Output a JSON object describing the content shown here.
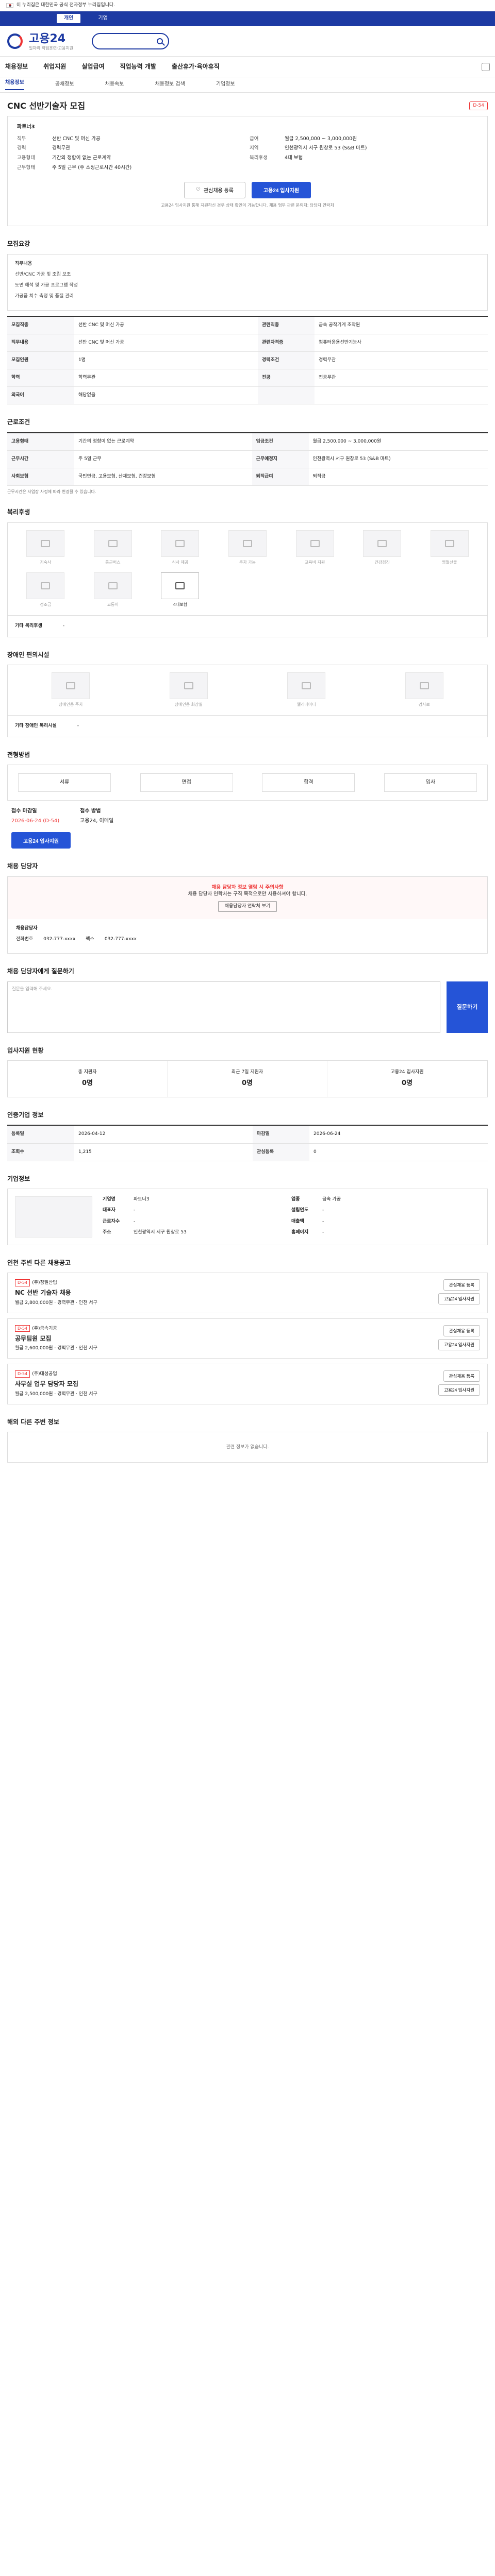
{
  "gov_banner": "이 누리집은 대한민국 공식 전자정부 누리집입니다.",
  "member_tabs": [
    "개인",
    "기업"
  ],
  "logo": {
    "title": "고용24",
    "sub": "일자리·직업훈련·고용지원"
  },
  "gnb": [
    "채용정보",
    "취업지원",
    "실업급여",
    "직업능력 개발",
    "출산휴가·육아휴직"
  ],
  "crumbs": [
    "채용정보",
    "공채정보",
    "채용속보",
    "채용정보 검색",
    "기업정보"
  ],
  "title": "CNC 선반기술자 모집",
  "dday": "D-54",
  "summary": {
    "company_head": "파트너3",
    "rows": [
      [
        "직무",
        "선반 CNC 및 머신 가공",
        "급여",
        "월급 2,500,000 ~ 3,000,000원"
      ],
      [
        "경력",
        "경력무관",
        "지역",
        "인천광역시 서구 원창로 53 (S&B 마트)"
      ],
      [
        "고용형태",
        "기간의 정함이 없는 근로계약",
        "복리후생",
        "4대 보험"
      ],
      [
        "근무형태",
        "주 5일 근무 (주 소정근로시간 40시간)",
        "",
        ""
      ]
    ]
  },
  "actions": {
    "save": "관심채용 등록",
    "apply": "고용24 입사지원"
  },
  "action_note": "고용24 입사지원 통해 지원하신 경우 상태 확인이 가능합니다. 채용 업무 관련 문의처: 담당자 연락처",
  "recruit": {
    "title": "모집요강",
    "desc_title": "직무내용",
    "desc": [
      "선반/CNC 가공 및 조립 보조",
      "도면 해석 및 가공 프로그램 작성",
      "가공품 치수 측정 및 품질 관리"
    ],
    "rows": [
      [
        "모집직종",
        "선반 CNC 및 머신 가공",
        "관련직종",
        "금속 공작기계 조작원"
      ],
      [
        "직무내용",
        "선반 CNC 및 머신 가공",
        "관련자격증",
        "컴퓨터응용선반기능사"
      ],
      [
        "모집인원",
        "1명",
        "경력조건",
        "경력무관"
      ],
      [
        "학력",
        "학력무관",
        "전공",
        "전공무관"
      ],
      [
        "외국어",
        "해당없음",
        "",
        ""
      ]
    ]
  },
  "conditions": {
    "title": "근로조건",
    "rows": [
      [
        "고용형태",
        "기간의 정함이 없는 근로계약",
        "임금조건",
        "월급 2,500,000 ~ 3,000,000원"
      ],
      [
        "근무시간",
        "주 5일 근무",
        "근무예정지",
        "인천광역시 서구 원창로 53 (S&B 마트)"
      ],
      [
        "사회보험",
        "국민연금, 고용보험, 산재보험, 건강보험",
        "퇴직급여",
        "퇴직금"
      ]
    ],
    "note": "근무시간은 사업장 사정에 따라 변경될 수 있습니다."
  },
  "welfare": {
    "title": "복리후생",
    "items": [
      "기숙사",
      "통근버스",
      "식사 제공",
      "주차 가능",
      "교육비 지원",
      "건강검진",
      "명절선물",
      "경조금",
      "교통비",
      "4대보험"
    ],
    "on": [
      9
    ],
    "extra_label": "기타 복리후생",
    "extra": "-"
  },
  "disabled": {
    "title": "장애인 편의시설",
    "items": [
      "장애인용 주차",
      "장애인용 화장실",
      "엘리베이터",
      "경사로"
    ],
    "extra_label": "기타 장애인 복리시설",
    "extra": "-"
  },
  "process": {
    "title": "전형방법",
    "steps": [
      "서류",
      "면접",
      "합격",
      "입사"
    ],
    "deadline_label": "접수 마감일",
    "deadline": "2026-06-24 (D-54)",
    "method_label": "접수 방법",
    "method": "고용24, 이메일"
  },
  "contact": {
    "title": "채용 담당자",
    "banner": "채용 담당자 정보 열람 시 주의사항",
    "sub": "채용 담당자 연락처는 구직 목적으로만 사용하셔야 합니다.",
    "button": "채용담당자 연락처 보기",
    "name_label": "채용담당자",
    "phone_label": "전화번호",
    "phone": "032-777-xxxx",
    "fax_label": "팩스",
    "fax": "032-777-xxxx"
  },
  "inquiry": {
    "title": "채용 담당자에게 질문하기",
    "placeholder": "질문을 입력해 주세요.",
    "button": "질문하기"
  },
  "stats": {
    "title": "입사지원 현황",
    "items": [
      {
        "label": "총 지원자",
        "value": "0명"
      },
      {
        "label": "최근 7일 지원자",
        "value": "0명"
      },
      {
        "label": "고용24 입사지원",
        "value": "0명"
      }
    ]
  },
  "info": {
    "title": "인증기업 정보",
    "rows": [
      [
        "등록일",
        "2026-04-12",
        "마감일",
        "2026-06-24"
      ],
      [
        "조회수",
        "1,215",
        "관심등록",
        "0"
      ]
    ]
  },
  "company": {
    "title": "기업정보",
    "rows": [
      [
        "기업명",
        "파트너3",
        "업종",
        "금속 가공"
      ],
      [
        "대표자",
        "-",
        "설립연도",
        "-"
      ],
      [
        "근로자수",
        "-",
        "매출액",
        "-"
      ],
      [
        "주소",
        "인천광역시 서구 원창로 53",
        "홈페이지",
        "-"
      ]
    ]
  },
  "others": {
    "title": "인천 주변 다른 채용공고",
    "jobs": [
      {
        "dday": "D-54",
        "company": "(주)정밀산업",
        "title": "NC 선반 기술자 채용",
        "info": "월급 2,800,000원 · 경력무관 · 인천 서구"
      },
      {
        "dday": "D-54",
        "company": "(주)금속기공",
        "title": "공무팀원 모집",
        "info": "월급 2,600,000원 · 경력무관 · 인천 서구"
      },
      {
        "dday": "D-54",
        "company": "(주)대성공업",
        "title": "사무실 업무 담당자 모집",
        "info": "월급 2,500,000원 · 경력무관 · 인천 서구"
      }
    ]
  },
  "similar": {
    "title": "해외 다른 주변 정보",
    "empty": "관련 정보가 없습니다."
  }
}
